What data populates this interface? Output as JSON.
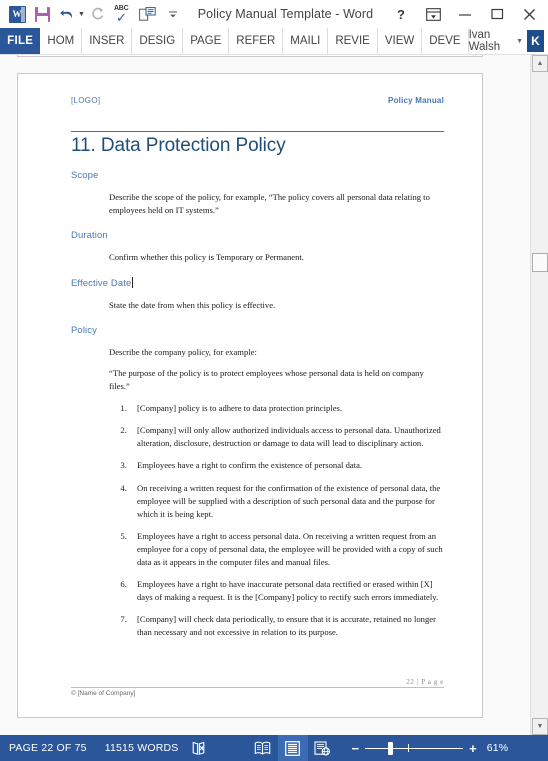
{
  "window": {
    "title": "Policy Manual Template - Word",
    "quick_access": [
      {
        "name": "word-app-icon",
        "label": "W"
      },
      {
        "name": "save-icon",
        "label": "Save"
      },
      {
        "name": "undo-icon",
        "label": "Undo"
      },
      {
        "name": "redo-icon",
        "label": "Redo"
      },
      {
        "name": "spelling-icon",
        "label": "ABC"
      },
      {
        "name": "touch-mouse-mode-icon",
        "label": "Touch/Mouse Mode"
      },
      {
        "name": "customize-quick-access-icon",
        "label": "Customize Quick Access Toolbar"
      }
    ],
    "controls": {
      "help": "?",
      "ribbon_display": "Ribbon Display Options",
      "minimize": "Minimize",
      "maximize": "Maximize",
      "close": "Close"
    }
  },
  "ribbon": {
    "file_tab": "FILE",
    "tabs": [
      "HOM",
      "INSER",
      "DESIG",
      "PAGE",
      "REFER",
      "MAILI",
      "REVIE",
      "VIEW",
      "DEVE"
    ],
    "account_name": "Ivan Walsh",
    "avatar_initial": "K"
  },
  "document": {
    "header": {
      "logo_placeholder": "[LOGO]",
      "right_label": "Policy Manual"
    },
    "title": "11. Data Protection Policy",
    "sections": [
      {
        "heading": "Scope",
        "has_caret": false,
        "body": [
          "Describe the scope of the policy, for example, “The policy covers all personal data relating to employees held on IT systems.”"
        ]
      },
      {
        "heading": "Duration",
        "has_caret": false,
        "body": [
          "Confirm whether this policy is Temporary or Permanent."
        ]
      },
      {
        "heading": "Effective Date",
        "has_caret": true,
        "body": [
          "State the date from when this policy is effective."
        ]
      },
      {
        "heading": "Policy",
        "has_caret": false,
        "body": [
          "Describe the company policy, for example:",
          "“The purpose of the policy is to protect employees whose personal data is held on company files.”"
        ]
      }
    ],
    "policy_list": [
      "[Company] policy is to adhere to data protection principles.",
      "[Company] will only allow authorized individuals access to personal data. Unauthorized alteration, disclosure, destruction or damage to data will lead to disciplinary action.",
      "Employees have a right to confirm the existence of personal data.",
      "On receiving a written request for the confirmation of the existence of personal data, the employee will be supplied with a description of such personal data and the purpose for which it is being kept.",
      "Employees have a right to access personal data. On receiving a written request from an employee for a copy of personal data, the employee will be provided with a copy of such data as it appears in the computer files and manual files.",
      "Employees have a right to have inaccurate personal data rectified or erased within [X] days of making a request. It is the [Company] policy to rectify such errors immediately.",
      "[Company] will check data periodically, to ensure that it is accurate, retained no longer than necessary and not excessive in relation to its purpose."
    ],
    "footer": {
      "page_number": "22 | P a g e",
      "company": "© [Name of Company]"
    }
  },
  "status_bar": {
    "page_info": "PAGE 22 OF 75",
    "word_count": "11515 WORDS",
    "proofing_icon_label": "Proofing errors",
    "views": [
      {
        "name": "read-mode-view-button",
        "label": "Read Mode",
        "active": false
      },
      {
        "name": "print-layout-view-button",
        "label": "Print Layout",
        "active": true
      },
      {
        "name": "web-layout-view-button",
        "label": "Web Layout",
        "active": false
      }
    ],
    "zoom_out": "−",
    "zoom_in": "+",
    "zoom_level": "61%"
  },
  "colors": {
    "word_blue": "#2b579a",
    "title_navy": "#1f4e79",
    "heading_blue": "#4a7ab5",
    "save_purple": "#b05fb0"
  }
}
